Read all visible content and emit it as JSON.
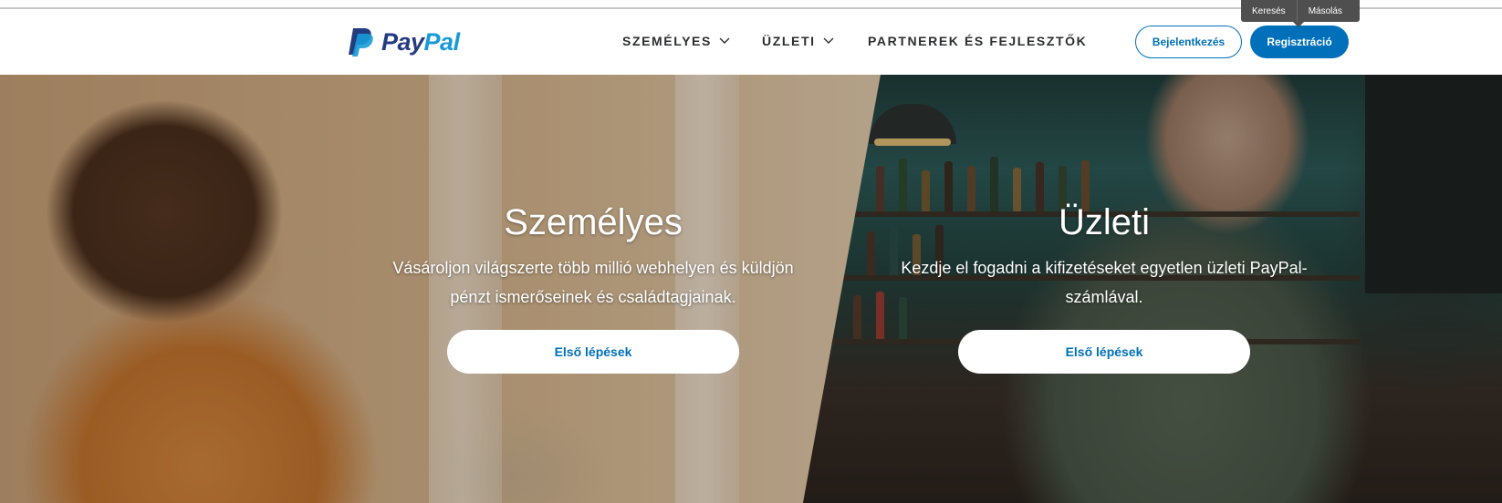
{
  "browser": {
    "tooltip": {
      "search_label": "Keresés",
      "copy_label": "Másolás"
    }
  },
  "header": {
    "brand": {
      "name_pay": "Pay",
      "name_pal": "Pal",
      "icon": "paypal-logo-icon"
    },
    "nav": [
      {
        "label": "SZEMÉLYES",
        "has_dropdown": true
      },
      {
        "label": "ÜZLETI",
        "has_dropdown": true
      },
      {
        "label": "PARTNEREK ÉS FEJLESZTŐK",
        "has_dropdown": false
      }
    ],
    "login_label": "Bejelentkezés",
    "register_label": "Regisztráció"
  },
  "hero": {
    "personal": {
      "title": "Személyes",
      "subtitle_line1": "Vásároljon világszerte több millió webhelyen és küldjön",
      "subtitle_line2": "pénzt ismerőseinek és családtagjainak.",
      "cta_label": "Első lépések"
    },
    "business": {
      "title": "Üzleti",
      "subtitle_line1": "Kezdje el fogadni a kifizetéseket egyetlen üzleti PayPal-",
      "subtitle_line2": "számlával.",
      "cta_label": "Első lépések"
    }
  },
  "colors": {
    "brand_primary": "#0070ba",
    "brand_dark": "#253b80",
    "brand_light": "#179bd7",
    "nav_text": "#2c2e2f"
  }
}
